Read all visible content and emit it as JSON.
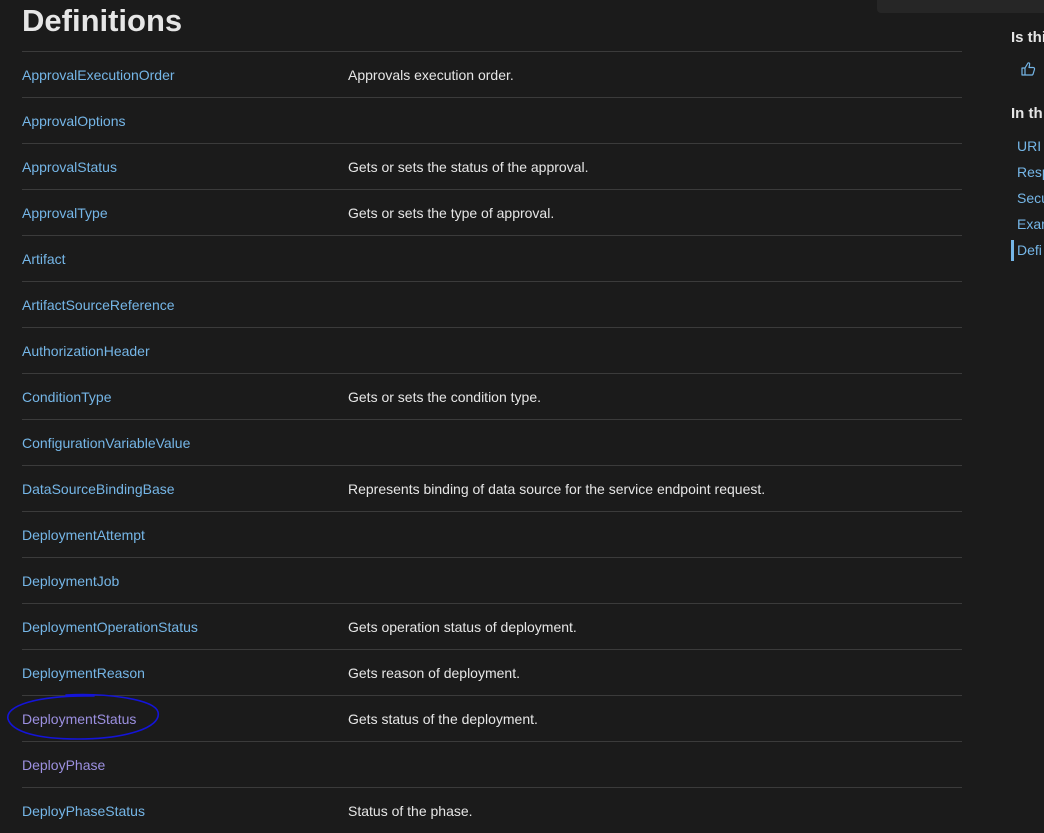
{
  "page": {
    "title": "Definitions"
  },
  "definitions": [
    {
      "name": "ApprovalExecutionOrder",
      "description": "Approvals execution order."
    },
    {
      "name": "ApprovalOptions",
      "description": ""
    },
    {
      "name": "ApprovalStatus",
      "description": "Gets or sets the status of the approval."
    },
    {
      "name": "ApprovalType",
      "description": "Gets or sets the type of approval."
    },
    {
      "name": "Artifact",
      "description": ""
    },
    {
      "name": "ArtifactSourceReference",
      "description": ""
    },
    {
      "name": "AuthorizationHeader",
      "description": ""
    },
    {
      "name": "ConditionType",
      "description": "Gets or sets the condition type."
    },
    {
      "name": "ConfigurationVariableValue",
      "description": ""
    },
    {
      "name": "DataSourceBindingBase",
      "description": "Represents binding of data source for the service endpoint request."
    },
    {
      "name": "DeploymentAttempt",
      "description": ""
    },
    {
      "name": "DeploymentJob",
      "description": ""
    },
    {
      "name": "DeploymentOperationStatus",
      "description": "Gets operation status of deployment."
    },
    {
      "name": "DeploymentReason",
      "description": "Gets reason of deployment."
    },
    {
      "name": "DeploymentStatus",
      "description": "Gets status of the deployment."
    },
    {
      "name": "DeployPhase",
      "description": ""
    },
    {
      "name": "DeployPhaseStatus",
      "description": "Status of the phase."
    }
  ],
  "rail": {
    "feedback_heading": "Is thi",
    "feedback_icon": "thumbs-up-icon",
    "toc_heading": "In th",
    "toc_items": [
      "URI",
      "Resp",
      "Secu",
      "Exam",
      "Defi"
    ],
    "toc_active": "Defi"
  },
  "colors": {
    "background": "#1b1b1b",
    "link": "#75b6e7",
    "visited_link": "#9c90e0",
    "annotation_circle": "#1414d8"
  }
}
